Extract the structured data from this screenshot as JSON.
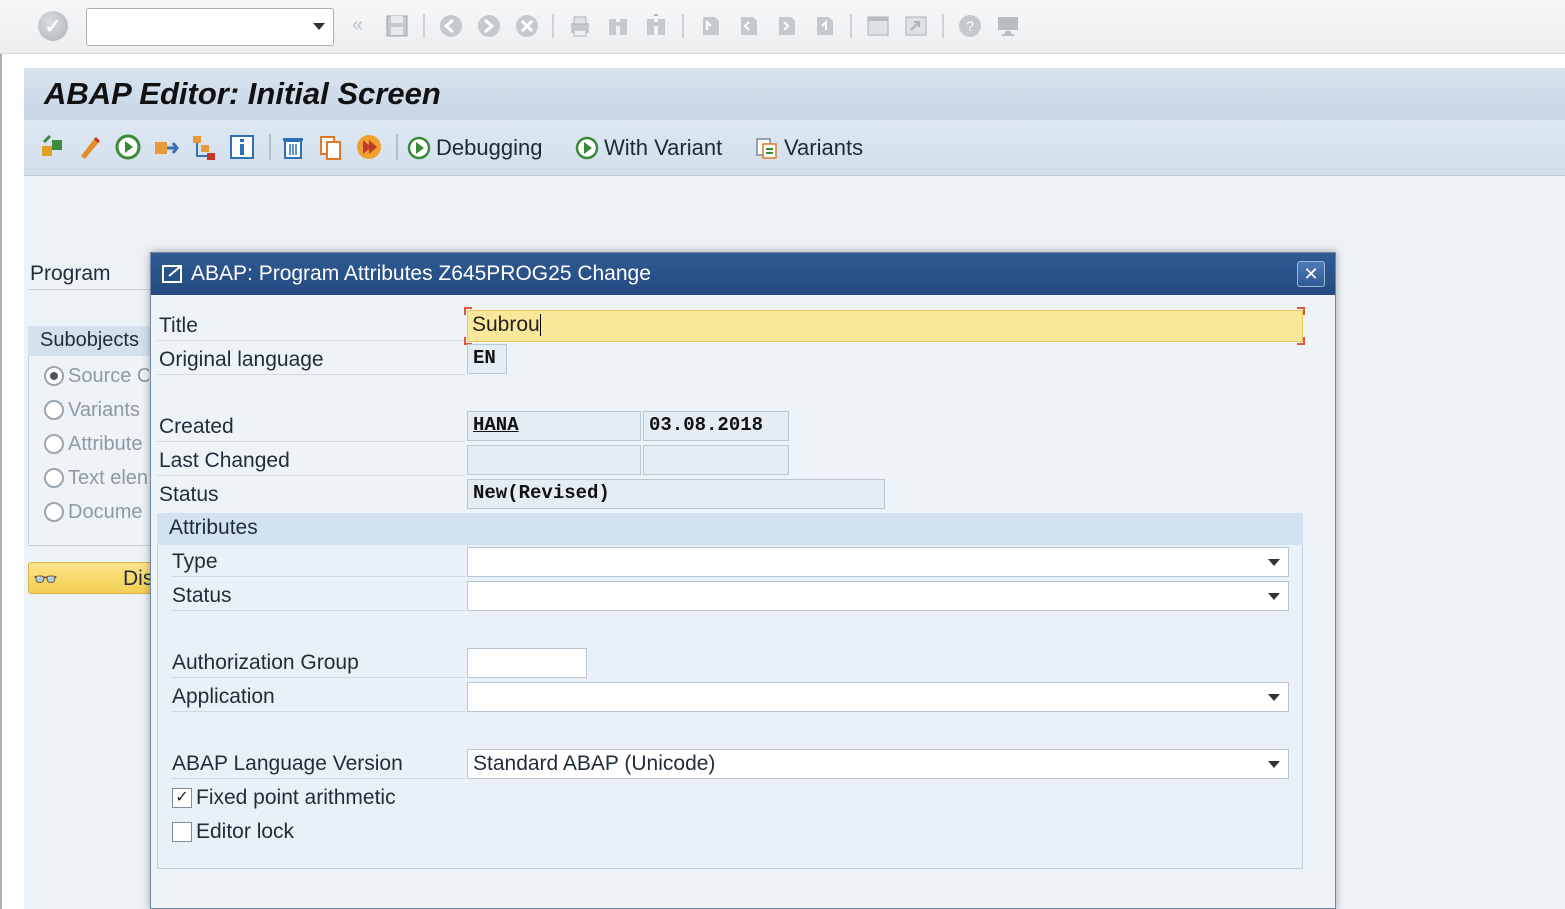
{
  "system_toolbar": {
    "command_field_value": "",
    "icons": [
      "enter-icon",
      "save-icon",
      "back-icon",
      "exit-icon",
      "cancel-icon",
      "print-icon",
      "find-icon",
      "find-next-icon",
      "first-page-icon",
      "previous-page-icon",
      "next-page-icon",
      "last-page-icon",
      "new-session-icon",
      "shortcut-icon",
      "help-icon",
      "customize-layout-icon"
    ]
  },
  "title_bar": {
    "title": "ABAP Editor: Initial Screen"
  },
  "app_toolbar": {
    "icons": [
      "other-object-icon",
      "change-pencil-icon",
      "activate-icon",
      "test-direct-icon",
      "where-used-icon",
      "info-icon",
      "delete-icon",
      "copy-icon",
      "execute-icon"
    ],
    "debugging_label": "Debugging",
    "with_variant_label": "With Variant",
    "variants_label": "Variants"
  },
  "background": {
    "program_label": "Program",
    "subobjects_title": "Subobjects",
    "subobjects": [
      {
        "label": "Source C",
        "selected": true
      },
      {
        "label": "Variants",
        "selected": false
      },
      {
        "label": "Attribute",
        "selected": false
      },
      {
        "label": "Text elen",
        "selected": false
      },
      {
        "label": "Docume",
        "selected": false
      }
    ],
    "display_button_label": "Dis"
  },
  "dialog": {
    "title": "ABAP: Program Attributes Z645PROG25 Change",
    "labels": {
      "title": "Title",
      "original_language": "Original language",
      "created": "Created",
      "last_changed": "Last Changed",
      "status": "Status"
    },
    "values": {
      "title": "Subrou",
      "original_language": "EN",
      "created_by": "HANA",
      "created_on": "03.08.2018",
      "last_changed_by": "",
      "last_changed_on": "",
      "status": "New(Revised)"
    },
    "attributes": {
      "heading": "Attributes",
      "type_label": "Type",
      "type_value": "",
      "status_label": "Status",
      "status_value": "",
      "auth_group_label": "Authorization Group",
      "auth_group_value": "",
      "application_label": "Application",
      "application_value": "",
      "lang_version_label": "ABAP Language Version",
      "lang_version_value": "Standard ABAP (Unicode)",
      "fixed_point_label": "Fixed point arithmetic",
      "fixed_point_checked": true,
      "editor_lock_label": "Editor lock",
      "editor_lock_checked": false
    }
  },
  "colors": {
    "dialog_title_bg": "#2a5189",
    "title_field_bg": "#fbe79a",
    "shell_bg": "#d2dfeb"
  }
}
